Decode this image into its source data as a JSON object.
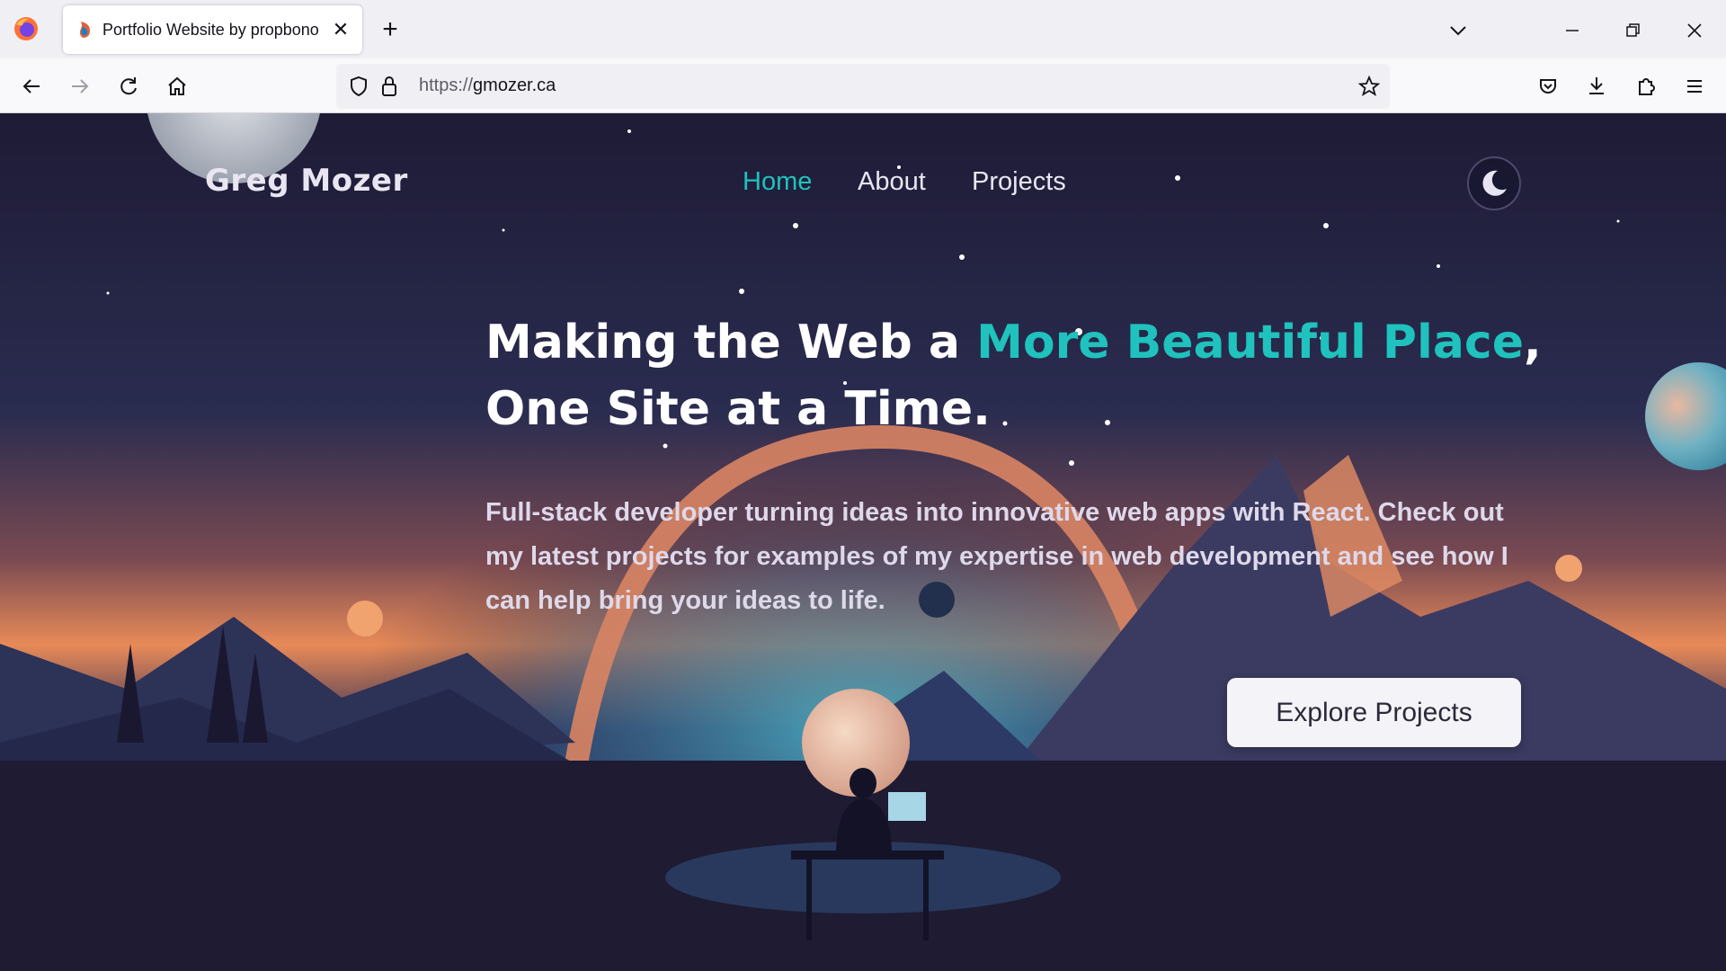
{
  "browser": {
    "tab": {
      "title": "Portfolio Website by propbono",
      "close_glyph": "✕"
    },
    "new_tab_glyph": "+",
    "url": {
      "scheme": "https://",
      "host": "gmozer.ca"
    }
  },
  "site": {
    "logo": "Greg Mozer",
    "nav": [
      {
        "label": "Home",
        "active": true
      },
      {
        "label": "About",
        "active": false
      },
      {
        "label": "Projects",
        "active": false
      }
    ],
    "theme_toggle_icon": "moon-icon",
    "hero": {
      "headline_part1": "Making the Web a ",
      "headline_accent": "More Beautiful Place",
      "headline_part2": ",",
      "headline_line2": "One Site at a Time.",
      "lead": "Full-stack developer turning ideas into innovative web apps with React. Check out my latest projects for examples of my expertise in web development and see how I can help bring your ideas to life.",
      "cta_label": "Explore Projects"
    },
    "colors": {
      "accent": "#1fc2bd",
      "background": "#1d1a33",
      "text": "#e9e6f2"
    }
  }
}
